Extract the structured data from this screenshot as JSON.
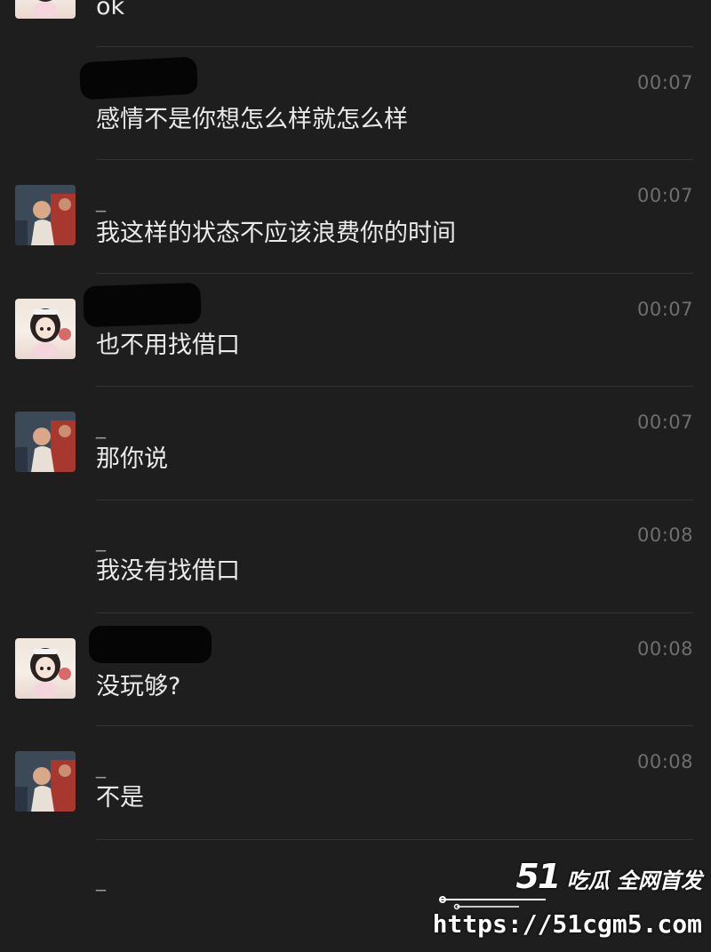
{
  "chat": {
    "messages": [
      {
        "sender": "",
        "avatar": "anime",
        "time": "",
        "text": "ok"
      },
      {
        "sender": "",
        "avatar": "none",
        "time": "00:07",
        "text": "感情不是你想怎么样就怎么样"
      },
      {
        "sender": "_",
        "avatar": "photo",
        "time": "00:07",
        "text": "我这样的状态不应该浪费你的时间"
      },
      {
        "sender": "",
        "avatar": "anime",
        "time": "00:07",
        "text": "也不用找借口"
      },
      {
        "sender": "_",
        "avatar": "photo",
        "time": "00:07",
        "text": "那你说"
      },
      {
        "sender": "_",
        "avatar": "none",
        "time": "00:08",
        "text": "我没有找借口"
      },
      {
        "sender": "",
        "avatar": "anime",
        "time": "00:08",
        "text": "没玩够?"
      },
      {
        "sender": "_",
        "avatar": "photo",
        "time": "00:08",
        "text": "不是"
      },
      {
        "sender": "_",
        "avatar": "none",
        "time": "",
        "text": ""
      }
    ]
  },
  "watermark": {
    "brand_number": "51",
    "brand_text": "吃瓜 全网首发",
    "url": "https://51cgm5.com"
  },
  "colors": {
    "background": "#1e1e1e",
    "text": "#eaeaea",
    "time": "#6f6f6f",
    "divider": "#333333"
  }
}
